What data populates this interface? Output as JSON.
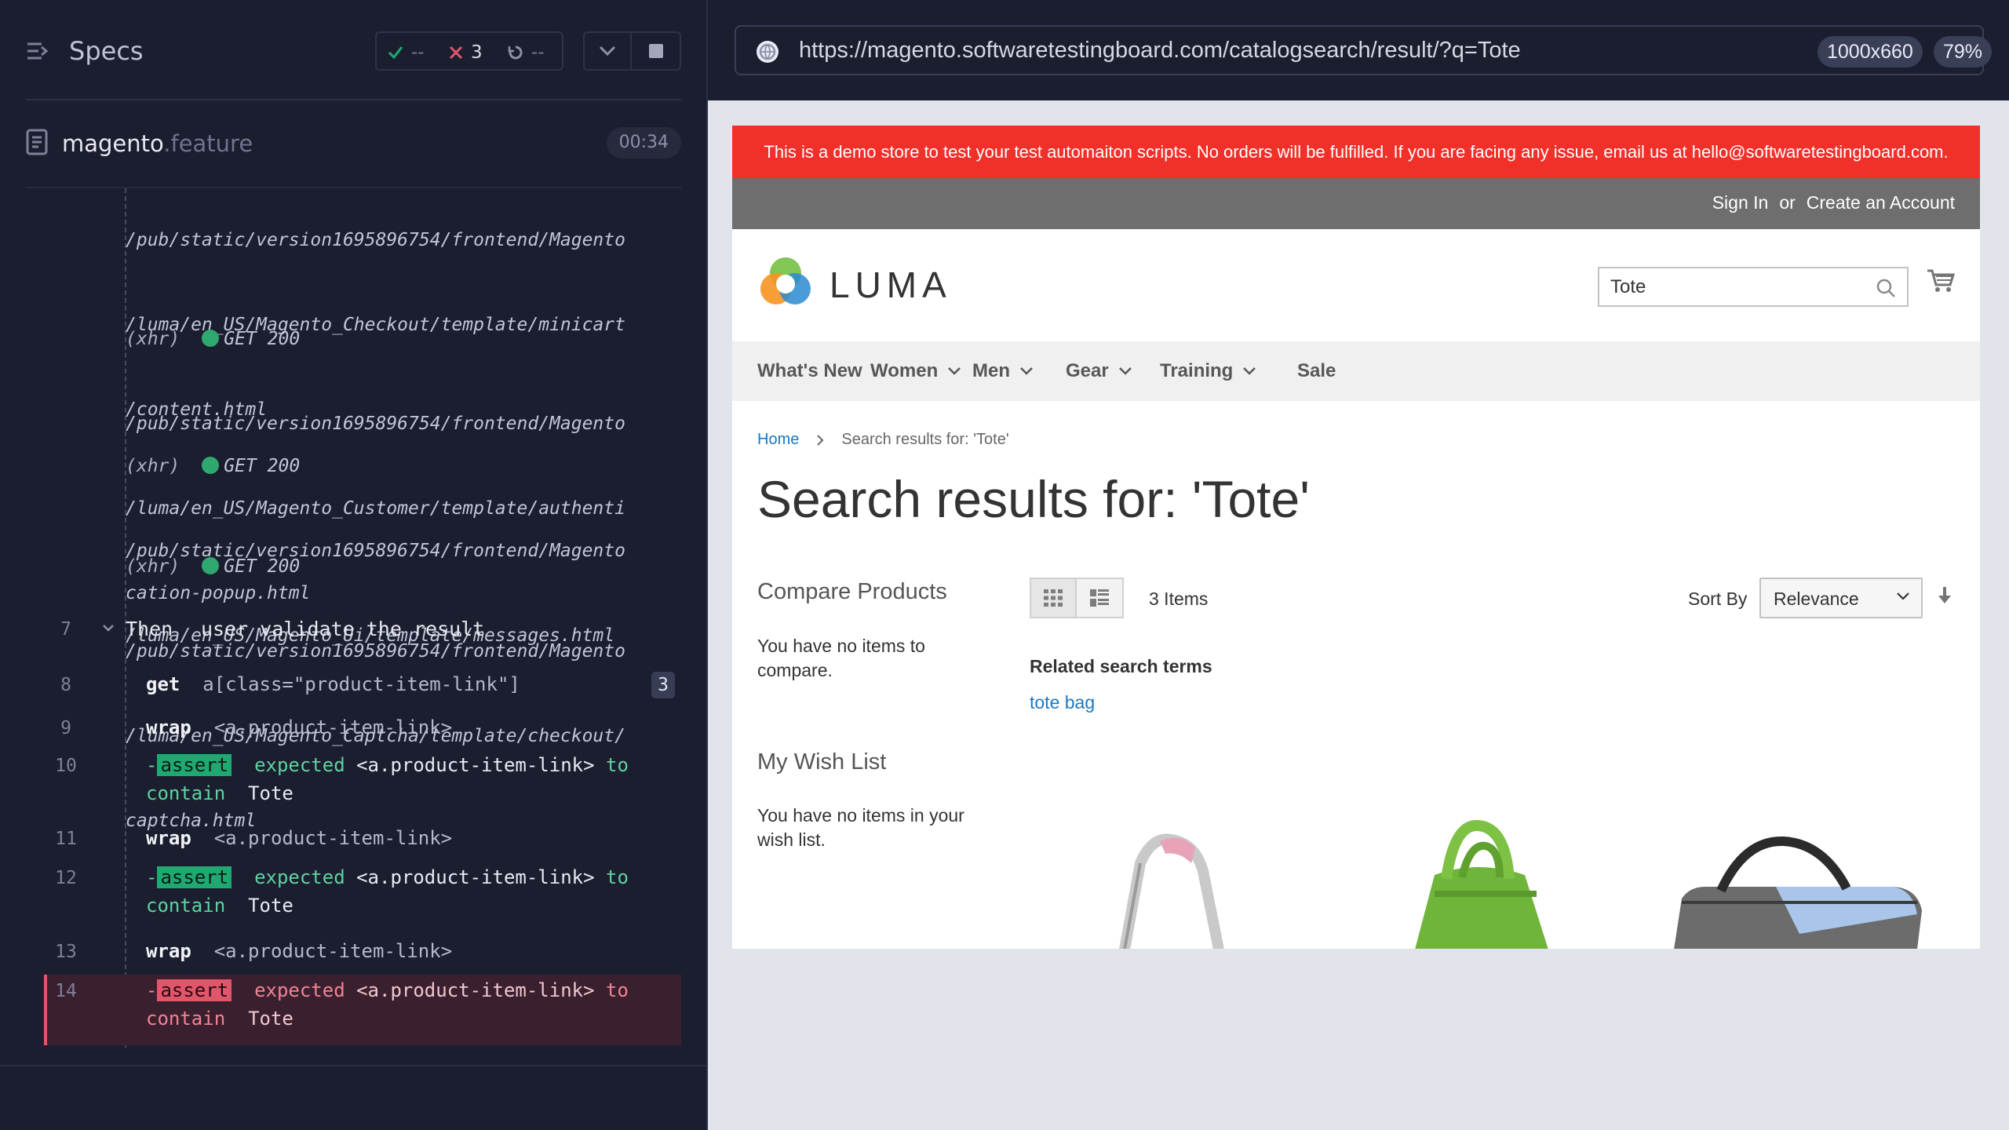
{
  "reporter": {
    "specs_title": "Specs",
    "stats": {
      "passed": "--",
      "failed": "3",
      "pending": "--"
    },
    "file": {
      "name": "magento",
      "ext": ".feature",
      "time": "00:34"
    },
    "xhr_blocks": [
      {
        "lines": [
          "/pub/static/version1695896754/frontend/Magento",
          "/luma/en_US/Magento_Checkout/template/minicart",
          "/content.html"
        ]
      },
      {
        "label": "(xhr)",
        "status": "GET 200",
        "lines": [
          "/pub/static/version1695896754/frontend/Magento",
          "/luma/en_US/Magento_Customer/template/authenti",
          "cation-popup.html"
        ]
      },
      {
        "label": "(xhr)",
        "status": "GET 200",
        "lines": [
          "/pub/static/version1695896754/frontend/Magento",
          "/luma/en_US/Magento_Ui/template/messages.html"
        ]
      },
      {
        "label": "(xhr)",
        "status": "GET 200",
        "lines": [
          "/pub/static/version1695896754/frontend/Magento",
          "/luma/en_US/Magento_Captcha/template/checkout/",
          "captcha.html"
        ]
      }
    ],
    "step": {
      "num": "7",
      "keyword": "Then",
      "text": "user validate the result"
    },
    "commands": [
      {
        "num": "8",
        "name": "get",
        "arg": "a[class=\"product-item-link\"]",
        "badge": "3"
      },
      {
        "num": "9",
        "name": "wrap",
        "arg": "<a.product-item-link>"
      },
      {
        "num": "10",
        "assert": "assert",
        "line1_pre": "expected",
        "line1_el": "<a.product-item-link>",
        "line1_post": "to",
        "line2_pre": "contain",
        "line2_val": "Tote"
      },
      {
        "num": "11",
        "name": "wrap",
        "arg": "<a.product-item-link>"
      },
      {
        "num": "12",
        "assert": "assert",
        "line1_pre": "expected",
        "line1_el": "<a.product-item-link>",
        "line1_post": "to",
        "line2_pre": "contain",
        "line2_val": "Tote"
      },
      {
        "num": "13",
        "name": "wrap",
        "arg": "<a.product-item-link>"
      },
      {
        "num": "14",
        "assert": "assert",
        "line1_pre": "expected",
        "line1_el": "<a.product-item-link>",
        "line1_post": "to",
        "line2_pre": "contain",
        "line2_val": "Tote"
      }
    ]
  },
  "aut": {
    "url": "https://magento.softwaretestingboard.com/catalogsearch/result/?q=Tote",
    "viewport": "1000x660",
    "zoom": "79%"
  },
  "site": {
    "banner": "This is a demo store to test your test automaiton scripts. No orders will be fulfilled. If you are facing any issue, email us at hello@softwaretestingboard.com.",
    "sign_in": "Sign In",
    "or": "or",
    "create_account": "Create an Account",
    "logo_text": "LUMA",
    "search_value": "Tote",
    "nav": [
      "What's New",
      "Women",
      "Men",
      "Gear",
      "Training",
      "Sale"
    ],
    "breadcrumb_home": "Home",
    "breadcrumb_current": "Search results for: 'Tote'",
    "page_title": "Search results for: 'Tote'",
    "compare_title": "Compare Products",
    "compare_empty": "You have no items to compare.",
    "wish_title": "My Wish List",
    "wish_empty": "You have no items in your wish list.",
    "items_count": "3 Items",
    "sort_label": "Sort By",
    "sort_value": "Relevance",
    "related_title": "Related search terms",
    "related_link": "tote bag"
  },
  "colors": {
    "banner": "#f1302a",
    "pass": "#1fa971",
    "fail": "#e0566b",
    "link": "#1979c3"
  }
}
